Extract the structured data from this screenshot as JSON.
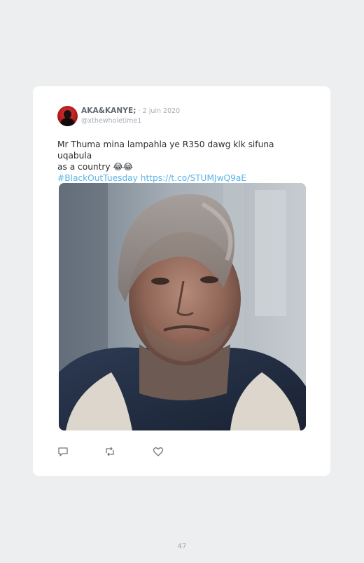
{
  "tweet": {
    "author_name": "AKA&KANYE;",
    "date_sep": " · ",
    "date": "2 juin 2020",
    "handle": "@xthewholetime1",
    "text_line1": "Mr Thuma mina lampahla ye R350 dawg klk sifuna uqabula",
    "text_line2": "as a country",
    "emojis": "😂😂",
    "hashtag": "#BlackOutTuesday",
    "link": "https://t.co/STUMJwQ9aE",
    "photo_icon": "photo-of-man-with-stocking-over-head",
    "actions": [
      "reply-icon",
      "retweet-icon",
      "like-icon"
    ]
  },
  "page_number": "47",
  "colors": {
    "link": "#5ab4e5",
    "text": "#2a2d31",
    "muted": "#a7adb4",
    "background": "#eceef0"
  }
}
